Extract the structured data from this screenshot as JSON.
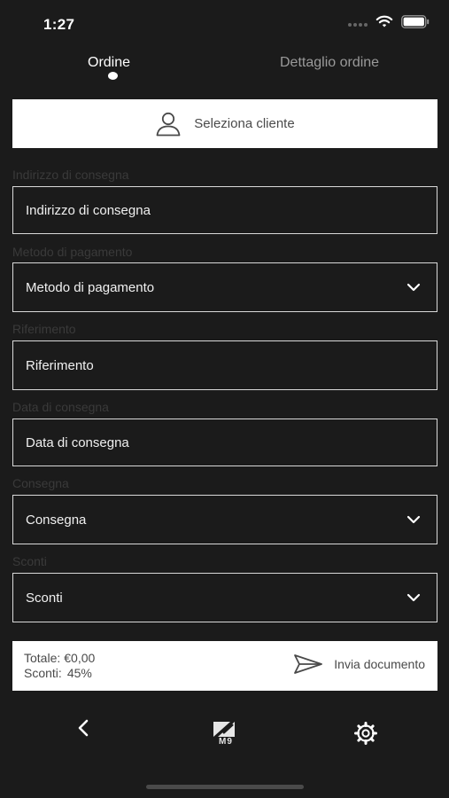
{
  "status": {
    "time": "1:27"
  },
  "tabs": [
    {
      "label": "Ordine",
      "active": true
    },
    {
      "label": "Dettaglio ordine",
      "active": false
    }
  ],
  "client": {
    "label": "Seleziona cliente",
    "icon": "person-icon"
  },
  "fields": [
    {
      "label": "Indirizzo di consegna",
      "value": "Indirizzo di consegna",
      "type": "input"
    },
    {
      "label": "Metodo di pagamento",
      "value": "Metodo di pagamento",
      "type": "select"
    },
    {
      "label": "Riferimento",
      "value": "Riferimento",
      "type": "input"
    },
    {
      "label": "Data di consegna",
      "value": "Data di consegna",
      "type": "input"
    },
    {
      "label": "Consegna",
      "value": "Consegna",
      "type": "select"
    },
    {
      "label": "Sconti",
      "value": "Sconti",
      "type": "select"
    }
  ],
  "footer": {
    "total_label": "Totale:",
    "total_value": "€0,00",
    "discount_label": "Sconti:",
    "discount_value": "45%",
    "send_label": "Invia documento",
    "send_icon": "send-icon"
  },
  "nav": {
    "logo_text": "M9",
    "items": [
      "back-icon",
      "m9-logo",
      "gear-icon"
    ]
  },
  "colors": {
    "background": "#1b1b1b",
    "panel": "#ffffff",
    "field_border": "#d9d9d9",
    "muted_label": "#3a3a3a"
  }
}
